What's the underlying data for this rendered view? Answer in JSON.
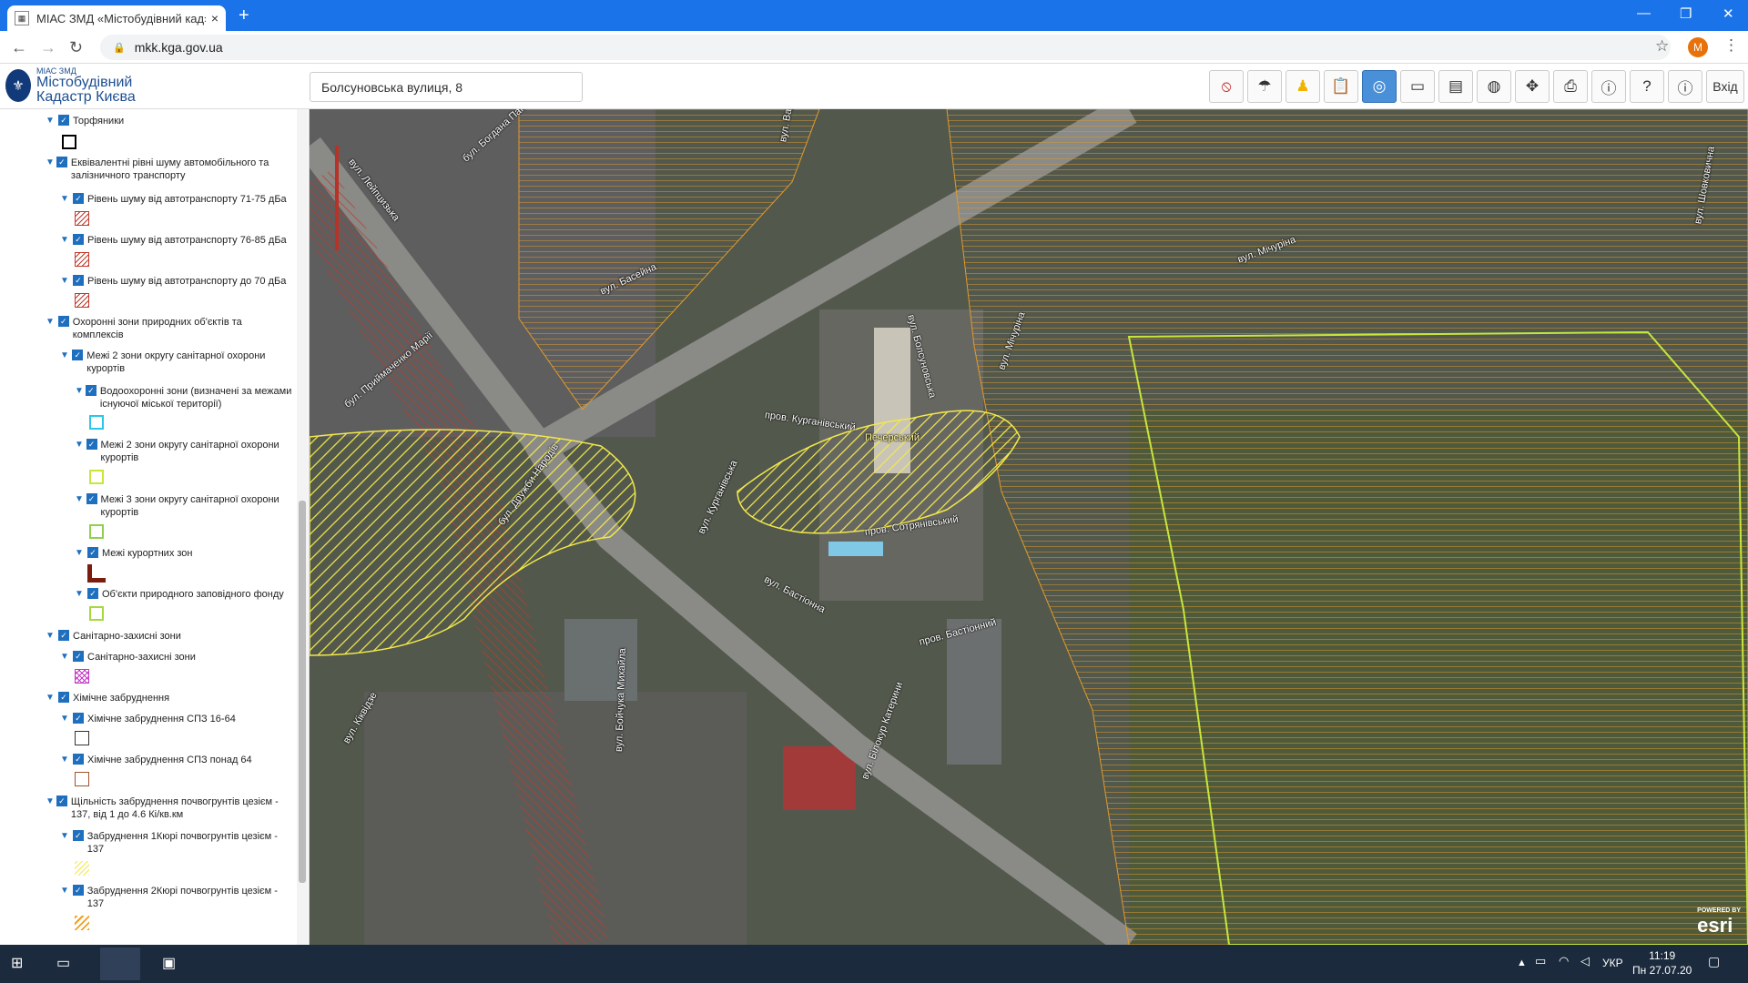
{
  "browser": {
    "tab_title": "МІАС ЗМД «Містобудівний кад»",
    "url": "mkk.kga.gov.ua",
    "new_tab": "+",
    "close": "×",
    "avatar": "M",
    "menu": "⋮",
    "star": "☆",
    "min": "—",
    "max": "❐",
    "winclose": "✕"
  },
  "app": {
    "logo_small": "МІАС ЗМД",
    "logo_line1": "Містобудівний",
    "logo_line2": "Кадастр Києва",
    "search_value": "Болсуновська вулиця, 8",
    "login": "Вхід"
  },
  "layers": [
    {
      "label": "Торфяники"
    },
    {
      "label": "Еквівалентні рівні шуму автомобільного та залізничного транспорту"
    },
    {
      "label": "Рівень шуму від автотранспорту 71-75 дБа"
    },
    {
      "label": "Рівень шуму від автотранспорту 76-85 дБа"
    },
    {
      "label": "Рівень шуму від автотранспорту до 70 дБа"
    },
    {
      "label": "Охоронні зони природних об'єктів та комплексів"
    },
    {
      "label": "Межі 2 зони округу санітарної охорони курортів"
    },
    {
      "label": "Водоохоронні зони (визначені за межами існуючої міської території)"
    },
    {
      "label": "Межі 2 зони округу санітарної охорони курортів"
    },
    {
      "label": "Межі 3 зони округу санітарної охорони курортів"
    },
    {
      "label": "Межі курортних зон"
    },
    {
      "label": "Об'єкти природного заповідного фонду"
    },
    {
      "label": "Санітарно-захисні зони"
    },
    {
      "label": "Санітарно-захисні зони"
    },
    {
      "label": "Хімічне забруднення"
    },
    {
      "label": "Хімічне забруднення СПЗ 16-64"
    },
    {
      "label": "Хімічне забруднення СПЗ понад 64"
    },
    {
      "label": "Щільність забруднення почвогрунтів цезієм - 137, від 1 до 4.6 Кі/кв.км"
    },
    {
      "label": "Забруднення 1Кюрі почвогрунтів цезієм - 137"
    },
    {
      "label": "Забруднення 2Кюрі почвогрунтів цезієм - 137"
    }
  ],
  "map_labels": [
    {
      "text": "вул. Лейпцизька",
      "color": "#ffffff"
    },
    {
      "text": "бул. Богдана Паня",
      "color": "#ffffff"
    },
    {
      "text": "вул. Басейна",
      "color": "#ffffff"
    },
    {
      "text": "вул. Варвин",
      "color": "#ffffff"
    },
    {
      "text": "вул. Мічуріна",
      "color": "#ffffff"
    },
    {
      "text": "вул. Шовковична",
      "color": "#ffffff"
    },
    {
      "text": "вул. Мічуріна",
      "color": "#ffffff"
    },
    {
      "text": "вул. Болсуновська",
      "color": "#ffffff"
    },
    {
      "text": "бул. Приймаченко Марії",
      "color": "#ffffff"
    },
    {
      "text": "пров. Курганівський",
      "color": "#ffffff"
    },
    {
      "text": "Печерський",
      "color": "#fff6a0"
    },
    {
      "text": "бул. Дружби Народів",
      "color": "#ffffff"
    },
    {
      "text": "вул. Курганівська",
      "color": "#ffffff"
    },
    {
      "text": "пров. Сотрянівський",
      "color": "#ffffff"
    },
    {
      "text": "вул. Бастіонна",
      "color": "#ffffff"
    },
    {
      "text": "пров. Бастіонний",
      "color": "#ffffff"
    },
    {
      "text": "вул. Кіквідзе",
      "color": "#ffffff"
    },
    {
      "text": "вул. Бойчука Михайла",
      "color": "#ffffff"
    },
    {
      "text": "вул. Білокур Катерини",
      "color": "#ffffff"
    }
  ],
  "attribution": {
    "powered": "POWERED BY",
    "esri": "esri"
  },
  "taskbar": {
    "lang": "УКР",
    "time": "11:19",
    "date": "Пн 27.07.20"
  },
  "colors": {
    "accent": "#1a73e8",
    "noise_hatch": "#c0392b",
    "zone_yellow": "#f2e84b",
    "zone_orange": "#e09a2c",
    "park_line": "#c6e63c"
  }
}
